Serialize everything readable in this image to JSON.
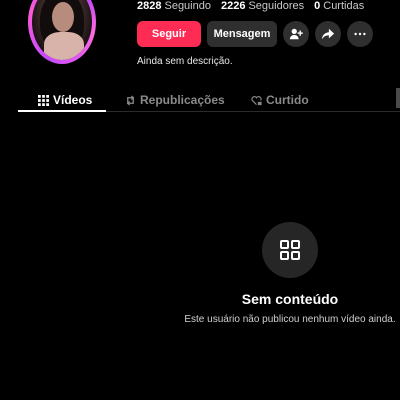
{
  "profile": {
    "stats": [
      {
        "value": "2828",
        "label": "Seguindo"
      },
      {
        "value": "2226",
        "label": "Seguidores"
      },
      {
        "value": "0",
        "label": "Curtidas"
      }
    ],
    "follow_label": "Seguir",
    "message_label": "Mensagem",
    "bio": "Ainda sem descrição."
  },
  "tabs": [
    {
      "label": "Vídeos",
      "icon": "grid-icon",
      "active": true
    },
    {
      "label": "Republicações",
      "icon": "repost-icon",
      "active": false
    },
    {
      "label": "Curtido",
      "icon": "heart-lock-icon",
      "active": false
    }
  ],
  "empty_state": {
    "icon": "grid-icon",
    "title": "Sem conteúdo",
    "subtitle": "Este usuário não publicou nenhum vídeo ainda."
  },
  "colors": {
    "background": "#000000",
    "accent": "#fe2c55",
    "secondary_button": "#2f2f2f"
  }
}
